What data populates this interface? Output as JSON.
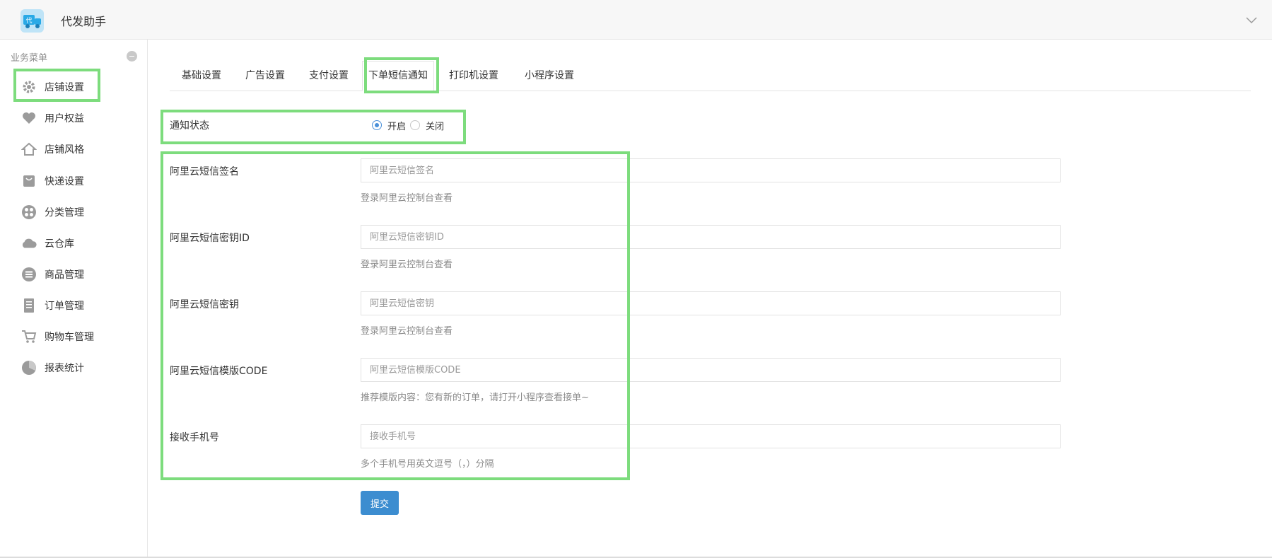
{
  "header": {
    "app_title": "代发助手",
    "logo_text": "代"
  },
  "sidebar": {
    "title": "业务菜单",
    "items": [
      {
        "label": "店铺设置",
        "icon": "gear-icon"
      },
      {
        "label": "用户权益",
        "icon": "heart-icon"
      },
      {
        "label": "店铺风格",
        "icon": "home-icon"
      },
      {
        "label": "快递设置",
        "icon": "bag-icon"
      },
      {
        "label": "分类管理",
        "icon": "grid-icon"
      },
      {
        "label": "云仓库",
        "icon": "cloud-icon"
      },
      {
        "label": "商品管理",
        "icon": "list-icon"
      },
      {
        "label": "订单管理",
        "icon": "document-icon"
      },
      {
        "label": "购物车管理",
        "icon": "cart-icon"
      },
      {
        "label": "报表统计",
        "icon": "pie-chart-icon"
      }
    ]
  },
  "tabs": [
    {
      "label": "基础设置"
    },
    {
      "label": "广告设置"
    },
    {
      "label": "支付设置"
    },
    {
      "label": "下单短信通知",
      "active": true
    },
    {
      "label": "打印机设置"
    },
    {
      "label": "小程序设置"
    }
  ],
  "form": {
    "notify_label": "通知状态",
    "notify_options": [
      {
        "label": "开启",
        "checked": true
      },
      {
        "label": "关闭",
        "checked": false
      }
    ],
    "fields": [
      {
        "label": "阿里云短信签名",
        "placeholder": "阿里云短信签名",
        "help": "登录阿里云控制台查看",
        "value": ""
      },
      {
        "label": "阿里云短信密钥ID",
        "placeholder": "阿里云短信密钥ID",
        "help": "登录阿里云控制台查看",
        "value": ""
      },
      {
        "label": "阿里云短信密钥",
        "placeholder": "阿里云短信密钥",
        "help": "登录阿里云控制台查看",
        "value": ""
      },
      {
        "label": "阿里云短信模版CODE",
        "placeholder": "阿里云短信模版CODE",
        "help": "推荐模版内容：您有新的订单，请打开小程序查看接单~",
        "value": ""
      },
      {
        "label": "接收手机号",
        "placeholder": "接收手机号",
        "help": "多个手机号用英文逗号（，）分隔",
        "value": ""
      }
    ],
    "submit_label": "提交"
  },
  "colors": {
    "accent": "#3c8dd0",
    "highlight": "#7ddc7d",
    "icon_gray": "#9b9b9b"
  }
}
